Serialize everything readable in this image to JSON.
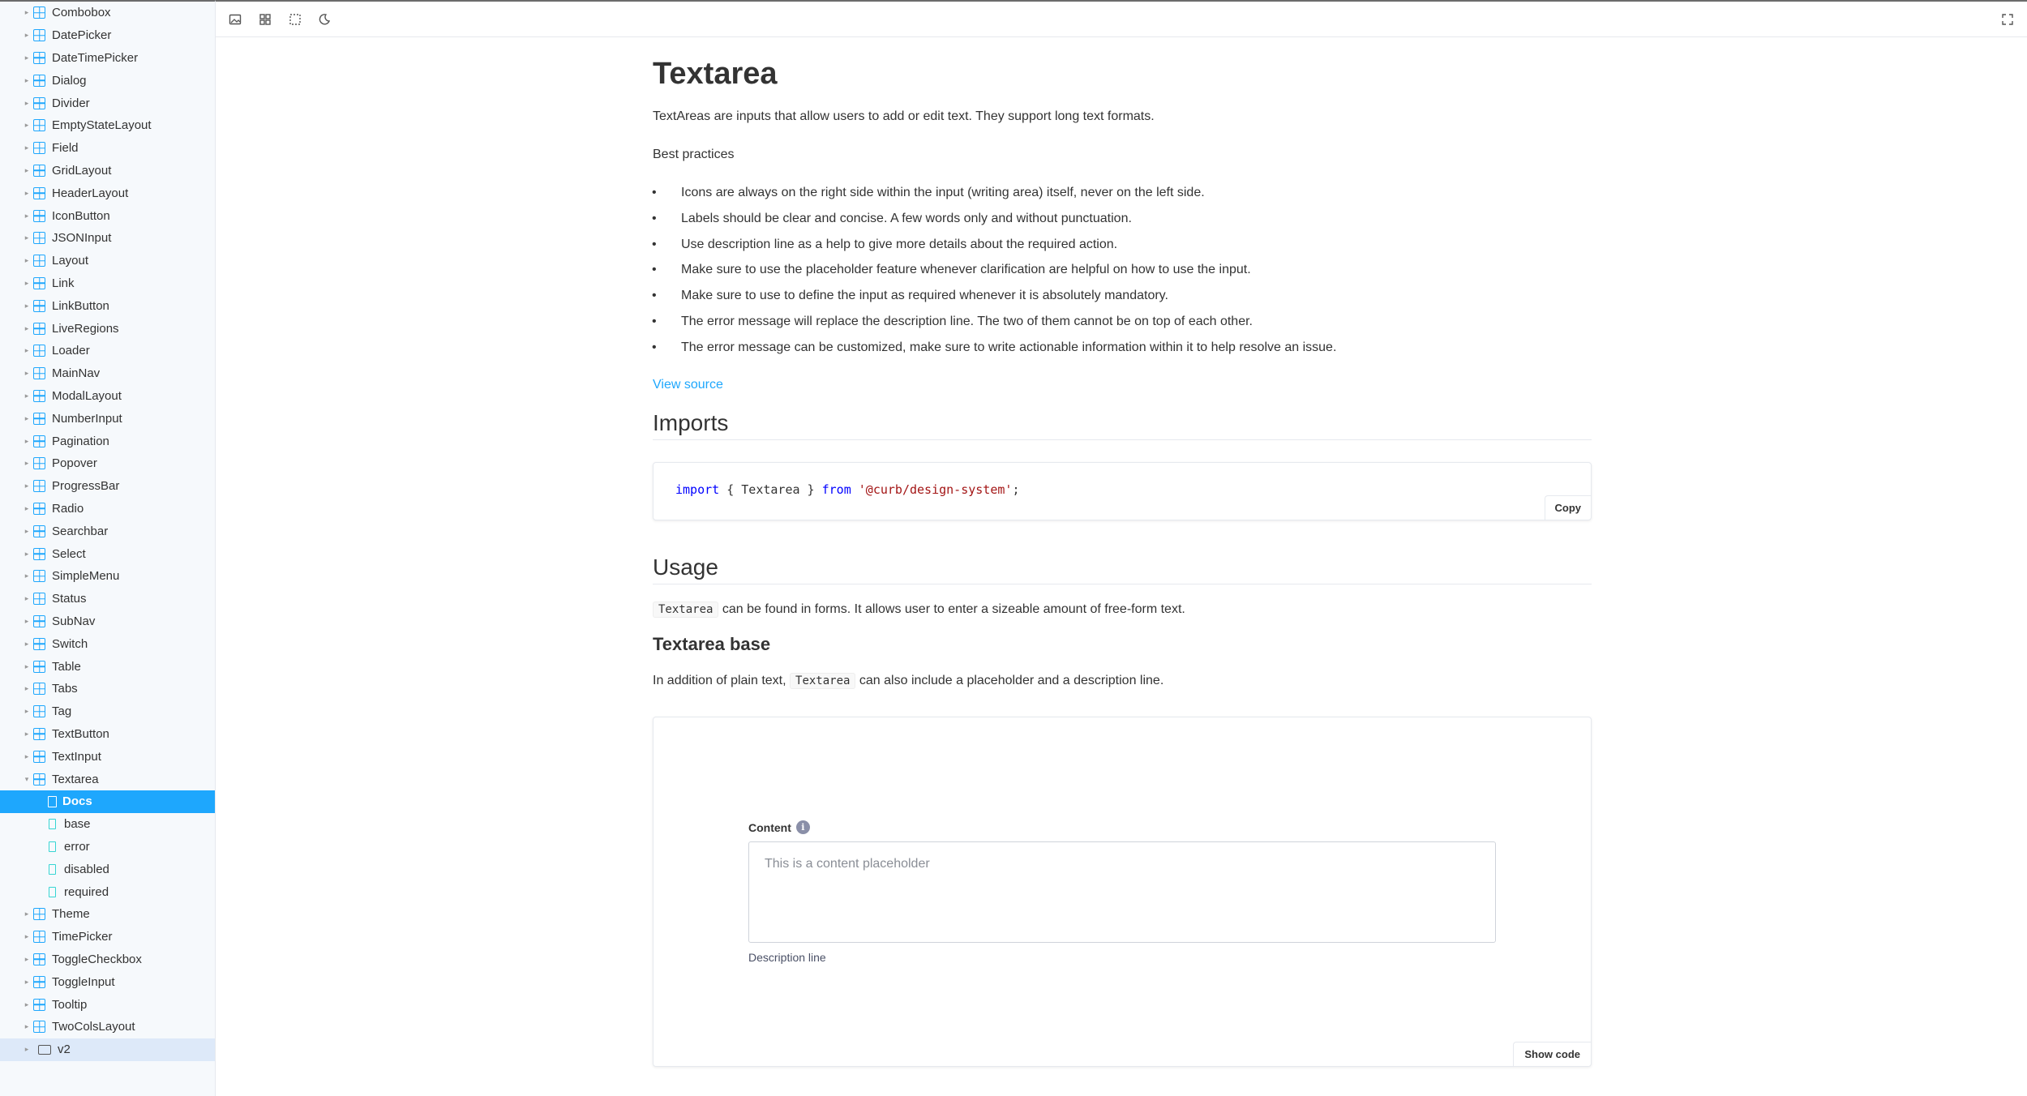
{
  "sidebar": {
    "components": [
      "Combobox",
      "DatePicker",
      "DateTimePicker",
      "Dialog",
      "Divider",
      "EmptyStateLayout",
      "Field",
      "GridLayout",
      "HeaderLayout",
      "IconButton",
      "JSONInput",
      "Layout",
      "Link",
      "LinkButton",
      "LiveRegions",
      "Loader",
      "MainNav",
      "ModalLayout",
      "NumberInput",
      "Pagination",
      "Popover",
      "ProgressBar",
      "Radio",
      "Searchbar",
      "Select",
      "SimpleMenu",
      "Status",
      "SubNav",
      "Switch",
      "Table",
      "Tabs",
      "Tag",
      "TextButton",
      "TextInput"
    ],
    "expanded": "Textarea",
    "children": [
      "Docs",
      "base",
      "error",
      "disabled",
      "required"
    ],
    "after": [
      "Theme",
      "TimePicker",
      "ToggleCheckbox",
      "ToggleInput",
      "Tooltip",
      "TwoColsLayout"
    ],
    "folder": "v2"
  },
  "toolbar": {
    "icons": [
      "image-icon",
      "grid-icon",
      "outline-icon",
      "moon-icon"
    ],
    "fullscreen_icon": "fullscreen-icon"
  },
  "doc": {
    "title": "Textarea",
    "intro": "TextAreas are inputs that allow users to add or edit text. They support long text formats.",
    "best_practices_heading": "Best practices",
    "bullets": [
      "Icons are always on the right side within the input (writing area) itself, never on the left side.",
      "Labels should be clear and concise. A few words only and without punctuation.",
      "Use description line as a help to give more details about the required action.",
      "Make sure to use the placeholder feature whenever clarification are helpful on how to use the input.",
      "Make sure to use to define the input as required whenever it is absolutely mandatory.",
      "The error message will replace the description line. The two of them cannot be on top of each other.",
      "The error message can be customized, make sure to write actionable information within it to help resolve an issue."
    ],
    "view_source": "View source",
    "imports_heading": "Imports",
    "code": {
      "kw_import": "import",
      "middle": " { Textarea } ",
      "kw_from": "from",
      "module": "'@curb/design-system'",
      "end": ";"
    },
    "copy_label": "Copy",
    "usage_heading": "Usage",
    "usage_code": "Textarea",
    "usage_text": "can be found in forms. It allows user to enter a sizeable amount of free-form text.",
    "base_heading": "Textarea base",
    "base_text_before": "In addition of plain text,",
    "base_code": "Textarea",
    "base_text_after": "can also include a placeholder and a description line.",
    "preview": {
      "label": "Content",
      "info_glyph": "i",
      "placeholder": "This is a content placeholder",
      "description": "Description line",
      "show_code": "Show code"
    }
  }
}
